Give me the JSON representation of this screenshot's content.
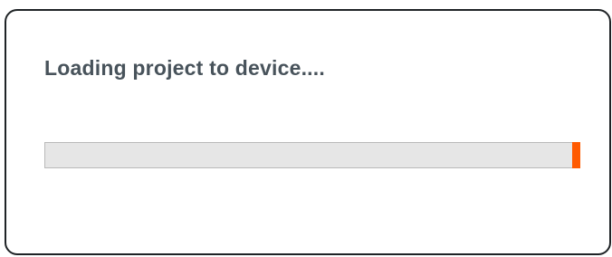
{
  "dialog": {
    "title": "Loading project to device...."
  },
  "progress": {
    "accent_color": "#ff5a00",
    "track_color": "#e6e6e6"
  }
}
